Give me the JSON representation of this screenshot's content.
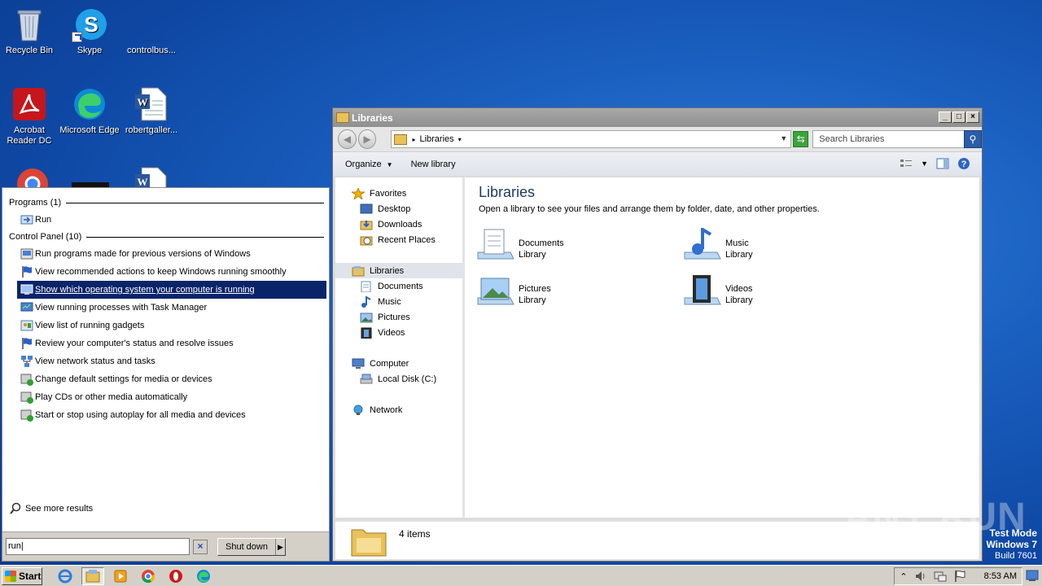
{
  "desktop": {
    "icons": [
      {
        "label": "Recycle Bin"
      },
      {
        "label": "Skype"
      },
      {
        "label": "controlbus..."
      },
      {
        "label": "Acrobat Reader DC"
      },
      {
        "label": "Microsoft Edge"
      },
      {
        "label": "robertgaller..."
      }
    ]
  },
  "explorer": {
    "title": "Libraries",
    "address": {
      "crumb": "Libraries"
    },
    "search": {
      "placeholder": "Search Libraries"
    },
    "toolbar": {
      "organize": "Organize",
      "new_library": "New library"
    },
    "nav": {
      "favorites": "Favorites",
      "desktop": "Desktop",
      "downloads": "Downloads",
      "recent": "Recent Places",
      "libraries": "Libraries",
      "documents": "Documents",
      "music": "Music",
      "pictures": "Pictures",
      "videos": "Videos",
      "computer": "Computer",
      "local_disk": "Local Disk (C:)",
      "network": "Network"
    },
    "content": {
      "heading": "Libraries",
      "description": "Open a library to see your files and arrange them by folder, date, and other properties.",
      "libraries": [
        {
          "name": "Documents",
          "type": "Library"
        },
        {
          "name": "Music",
          "type": "Library"
        },
        {
          "name": "Pictures",
          "type": "Library"
        },
        {
          "name": "Videos",
          "type": "Library"
        }
      ]
    },
    "status": {
      "count": "4 items"
    }
  },
  "startmenu": {
    "programs_header": "Programs (1)",
    "programs": [
      {
        "label": "Run"
      }
    ],
    "cp_header": "Control Panel (10)",
    "cp_items": [
      {
        "label": "Run programs made for previous versions of Windows"
      },
      {
        "label": "View recommended actions to keep Windows running smoothly"
      },
      {
        "label": "Show which operating system your computer is running"
      },
      {
        "label": "View running processes with Task Manager"
      },
      {
        "label": "View list of running gadgets"
      },
      {
        "label": "Review your computer's status and resolve issues"
      },
      {
        "label": "View network status and tasks"
      },
      {
        "label": "Change default settings for media or devices"
      },
      {
        "label": "Play CDs or other media automatically"
      },
      {
        "label": "Start or stop using autoplay for all media and devices"
      }
    ],
    "see_more": "See more results",
    "search_value": "run",
    "shutdown": "Shut down"
  },
  "taskbar": {
    "start": "Start",
    "clock": "8:53 AM"
  },
  "watermark": "ANY RUN",
  "testmode": {
    "line1": "Test Mode",
    "line2": "Windows 7",
    "line3": "Build 7601"
  }
}
